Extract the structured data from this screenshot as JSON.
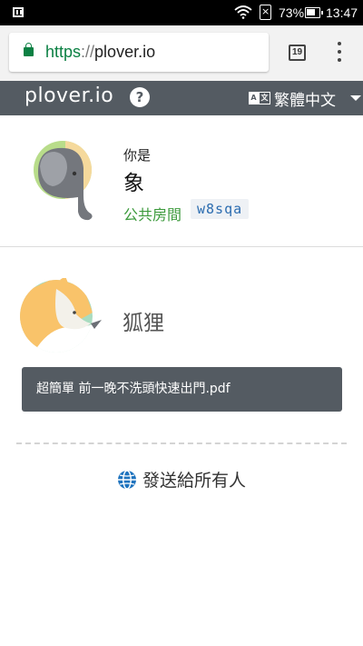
{
  "status_bar": {
    "battery_percent": "73%",
    "time": "13:47"
  },
  "browser": {
    "url_scheme": "https",
    "url_separator": "://",
    "url_host": "plover.io",
    "tab_count": "19",
    "secure_color": "#0b8043"
  },
  "header": {
    "brand": "plover.io",
    "help_symbol": "?",
    "language_icon_left": "A",
    "language_icon_right": "文",
    "language_label": "繁體中文",
    "background_color": "#545b62"
  },
  "me": {
    "caption": "你是",
    "name": "象",
    "avatar_icon": "elephant-icon",
    "room_label": "公共房間",
    "room_code": "w8sqa"
  },
  "peer": {
    "name": "狐狸",
    "avatar_icon": "fox-icon",
    "file_name": "超簡單 前一晚不洗頭快速出門.pdf"
  },
  "broadcast": {
    "label": "發送給所有人",
    "icon": "globe-icon"
  }
}
